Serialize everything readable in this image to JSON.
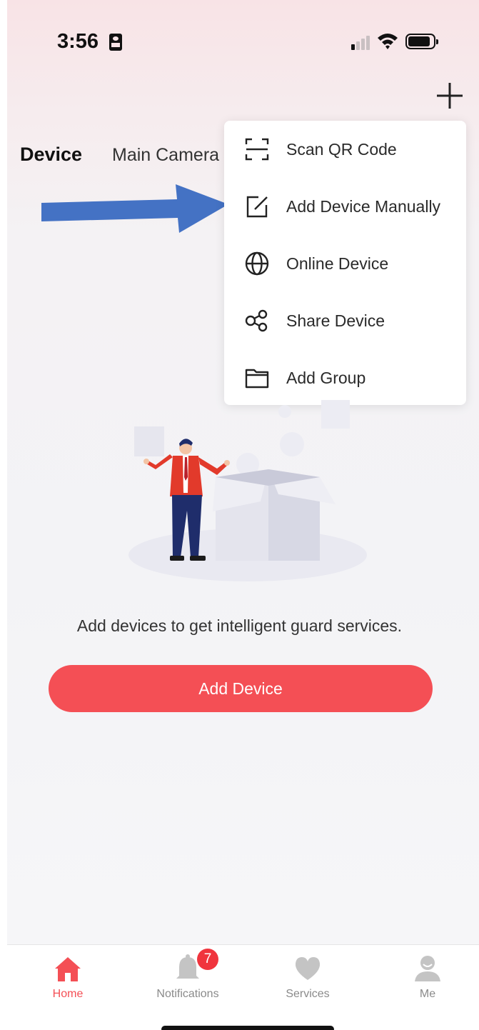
{
  "status_bar": {
    "time": "3:56"
  },
  "header": {
    "tabs": [
      {
        "label": "Device"
      },
      {
        "label": "Main Camera"
      }
    ]
  },
  "menu": {
    "items": [
      {
        "label": "Scan QR Code",
        "icon": "scan-qr-icon"
      },
      {
        "label": "Add Device Manually",
        "icon": "edit-square-icon"
      },
      {
        "label": "Online Device",
        "icon": "globe-icon"
      },
      {
        "label": "Share Device",
        "icon": "share-icon"
      },
      {
        "label": "Add Group",
        "icon": "folder-icon"
      }
    ]
  },
  "empty_state": {
    "message": "Add devices to get intelligent guard services.",
    "button_label": "Add Device"
  },
  "tab_bar": {
    "items": [
      {
        "label": "Home",
        "icon": "home-icon",
        "active": true
      },
      {
        "label": "Notifications",
        "icon": "bell-icon",
        "badge": "7"
      },
      {
        "label": "Services",
        "icon": "heart-icon"
      },
      {
        "label": "Me",
        "icon": "person-icon"
      }
    ]
  },
  "colors": {
    "accent": "#f44f55",
    "arrow": "#4472c4",
    "badge": "#f0343d",
    "inactive": "#8a8a8a"
  }
}
